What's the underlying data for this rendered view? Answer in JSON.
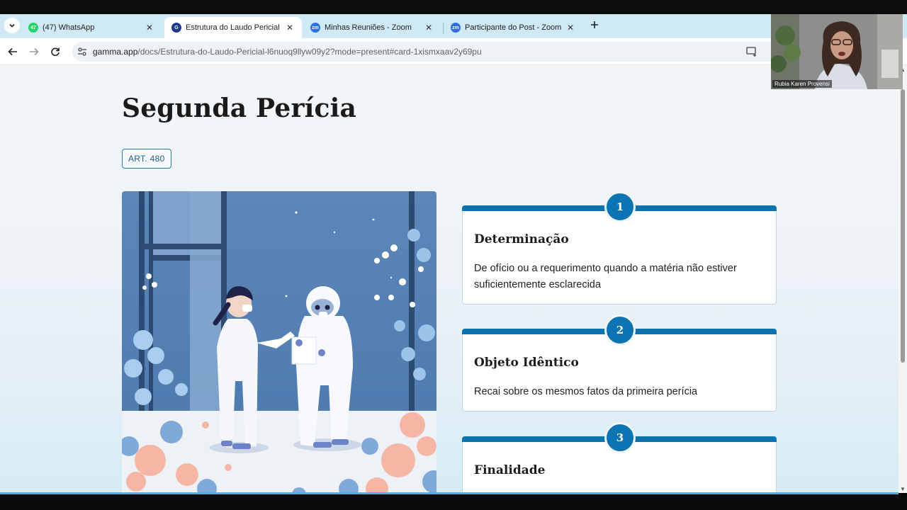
{
  "browser": {
    "tabs": [
      {
        "title": "(47) WhatsApp",
        "badge": "47",
        "active": false
      },
      {
        "title": "Estrutura do Laudo Pericial | Ga",
        "active": true
      },
      {
        "title": "Minhas Reuniões - Zoom",
        "favicon_text": "zm",
        "active": false
      },
      {
        "title": "Participante do Post - Zoom",
        "favicon_text": "zm",
        "active": false
      }
    ],
    "url_host": "gamma.app",
    "url_path": "/docs/Estrutura-do-Laudo-Pericial-l6nuoq9llyw09y2?mode=present#card-1xismxaav2y69pu"
  },
  "slide": {
    "title": "Segunda Perícia",
    "badge": "ART. 480",
    "steps": [
      {
        "number": "1",
        "heading": "Determinação",
        "text": "De ofício ou a requerimento quando a matéria não estiver suficientemente esclarecida"
      },
      {
        "number": "2",
        "heading": "Objeto Idêntico",
        "text": "Recai sobre os mesmos fatos da primeira perícia"
      },
      {
        "number": "3",
        "heading": "Finalidade",
        "text": ""
      }
    ]
  },
  "video": {
    "participant_name": "Rubia Karen Provensi"
  },
  "colors": {
    "accent": "#0b75b3",
    "tab_bar": "#cfeaf5",
    "whatsapp": "#25d366",
    "zoom": "#2d6fe0",
    "gamma": "#1e3a8a"
  }
}
